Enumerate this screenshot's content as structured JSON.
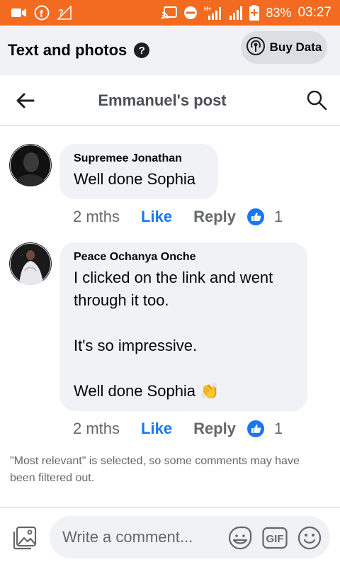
{
  "status_bar": {
    "battery": "83%",
    "time": "03:27",
    "icons": [
      "video-icon",
      "facebook-icon",
      "signal-unknown-icon",
      "cast-icon",
      "do-not-disturb-icon",
      "h-plus-signal-icon",
      "signal-icon",
      "battery-icon"
    ]
  },
  "header": {
    "title": "Text and photos",
    "help_label": "?",
    "buy_data_label": "Buy Data"
  },
  "post_header": {
    "title": "Emmanuel's post"
  },
  "comments": [
    {
      "name": "Supremee Jonathan",
      "text": "Well done Sophia",
      "time": "2 mths",
      "like_label": "Like",
      "reply_label": "Reply",
      "reaction_count": "1"
    },
    {
      "name": "Peace Ochanya Onche",
      "text": "I clicked on the link and went\nthrough it too.\n\nIt's so impressive.\n\nWell done Sophia",
      "emoji": "👏",
      "time": "2 mths",
      "like_label": "Like",
      "reply_label": "Reply",
      "reaction_count": "1"
    }
  ],
  "filter_note": "\"Most relevant\" is selected, so some comments may have been filtered out.",
  "composer": {
    "placeholder": "Write a comment...",
    "gif_label": "GIF"
  },
  "colors": {
    "status_bar": "#f26b21",
    "accent": "#1877f2",
    "bubble": "#f0f2f5"
  }
}
